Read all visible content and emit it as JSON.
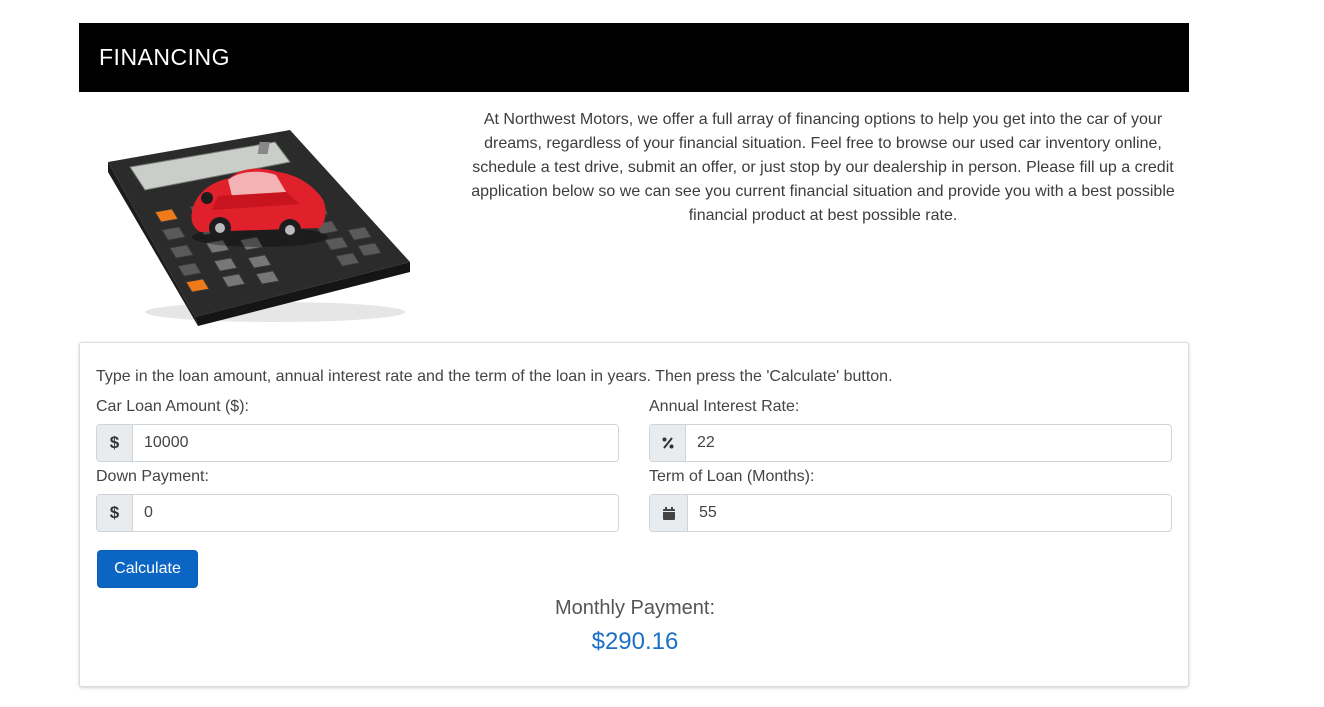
{
  "header": {
    "title": "FINANCING"
  },
  "intro": {
    "text": "At Northwest Motors, we offer a full array of financing options to help you get into the car of your dreams, regardless of your financial situation. Feel free to browse our used car inventory online, schedule a test drive, submit an offer, or just stop by our dealership in person. Please fill up a credit application below so we can see you current financial situation and provide you with a best possible financial product at best possible rate."
  },
  "image": {
    "icon": "calculator-with-red-car"
  },
  "calculator": {
    "instructions": "Type in the loan amount, annual interest rate and the term of the loan in years. Then press the 'Calculate' button.",
    "loan_amount": {
      "label": "Car Loan Amount ($):",
      "addon": "$",
      "value": "10000"
    },
    "interest_rate": {
      "label": "Annual Interest Rate:",
      "addon": "%",
      "value": "22"
    },
    "down_payment": {
      "label": "Down Payment:",
      "addon": "$",
      "value": "0"
    },
    "term": {
      "label": "Term of Loan (Months):",
      "addon_icon": "calendar-icon",
      "value": "55"
    },
    "button_label": "Calculate",
    "result_label": "Monthly Payment:",
    "result_value": "$290.16"
  },
  "colors": {
    "header_bg": "#000000",
    "button": "#0a66c2",
    "result": "#1c6fc4"
  }
}
